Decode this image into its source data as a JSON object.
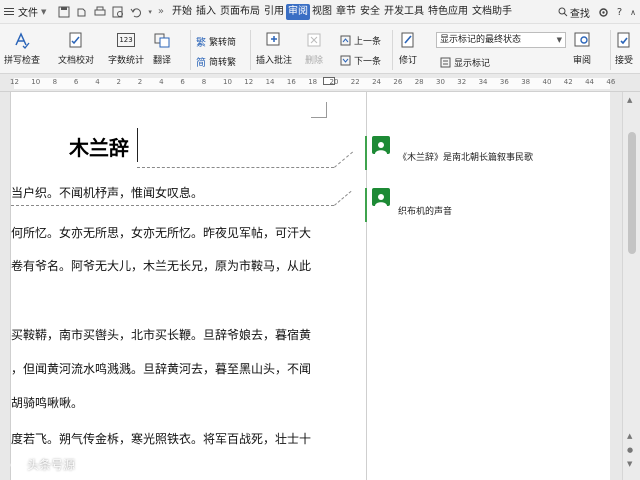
{
  "menubar": {
    "file_label": "文件",
    "tabs": [
      "开始",
      "插入",
      "页面布局",
      "引用",
      "审阅",
      "视图",
      "章节",
      "安全",
      "开发工具",
      "特色应用",
      "文档助手"
    ],
    "active_tab": "审阅",
    "search_label": "查找"
  },
  "ribbon": {
    "spell_check": "拼写检查",
    "doc_proof": "文档校对",
    "word_count": "字数统计",
    "translate": "翻译",
    "trad_to_simp": "繁转简",
    "simp_to_trad": "简转繁",
    "insert_comment": "插入批注",
    "delete": "删除",
    "prev": "上一条",
    "next": "下一条",
    "revise": "修订",
    "show_markup": "显示标记",
    "display_mode": "显示标记的最终状态",
    "review": "审阅",
    "accept": "接受",
    "word_count_icon_text": "123"
  },
  "ruler": {
    "numbers": [
      "12",
      "10",
      "8",
      "6",
      "4",
      "2",
      "2",
      "4",
      "6",
      "8",
      "10",
      "12",
      "14",
      "16",
      "18",
      "20",
      "22",
      "24",
      "26",
      "28",
      "30",
      "32",
      "34",
      "36",
      "38",
      "40",
      "42",
      "44",
      "46"
    ]
  },
  "document": {
    "title": "木兰辞",
    "lines": [
      "当户织。不闻机杼声，惟闻女叹息。",
      "何所忆。女亦无所思，女亦无所忆。昨夜见军帖，可汗大",
      "卷有爷名。阿爷无大儿，木兰无长兄，原为市鞍马，从此",
      "买鞍鞯，南市买辔头，北市买长鞭。旦辞爷娘去，暮宿黄",
      "，但闻黄河流水鸣溅溅。旦辞黄河去，暮至黑山头，不闻",
      "胡骑鸣啾啾。",
      "度若飞。朔气传金柝，寒光照铁衣。将军百战死，壮士十"
    ]
  },
  "comments": [
    {
      "text": "《木兰辞》是南北朝长篇叙事民歌"
    },
    {
      "text": "织布机的声音"
    }
  ],
  "watermark": "头条号源",
  "colors": {
    "accent": "#3a6fc4",
    "comment_green": "#1d8a35",
    "comment_bar": "#3fa34d"
  }
}
